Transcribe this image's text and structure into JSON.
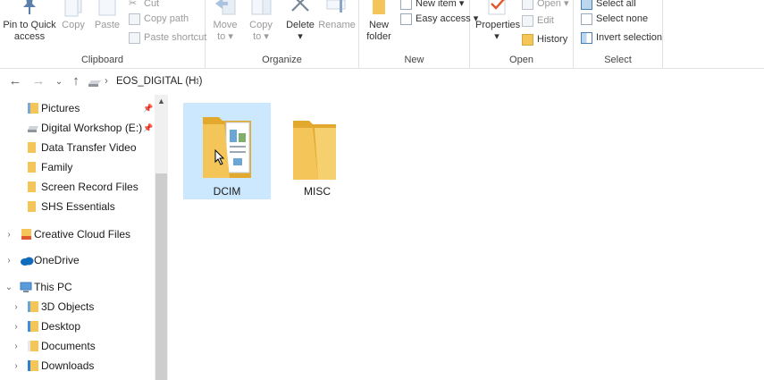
{
  "ribbon": {
    "clipboard": {
      "label": "Clipboard",
      "pin_label_line1": "Pin to Quick",
      "pin_label_line2": "access",
      "copy_label": "Copy",
      "paste_label": "Paste",
      "cut_label": "Cut",
      "copy_path_label": "Copy path",
      "paste_shortcut_label": "Paste shortcut"
    },
    "organize": {
      "label": "Organize",
      "move_to_line1": "Move",
      "move_to_line2": "to",
      "copy_to_line1": "Copy",
      "copy_to_line2": "to",
      "delete_label": "Delete",
      "rename_label": "Rename"
    },
    "new": {
      "label": "New",
      "new_folder_line1": "New",
      "new_folder_line2": "folder",
      "new_item_label": "New item",
      "easy_access_label": "Easy access"
    },
    "open": {
      "label": "Open",
      "properties_label": "Properties",
      "open_label": "Open",
      "edit_label": "Edit",
      "history_label": "History"
    },
    "select": {
      "label": "Select",
      "select_all_label": "Select all",
      "select_none_label": "Select none",
      "invert_selection_label": "Invert selection"
    }
  },
  "address": {
    "path_segment": "EOS_DIGITAL (H:)"
  },
  "nav": {
    "quick_access": [
      {
        "label": "Pictures",
        "pinned": true
      },
      {
        "label": "Digital Workshop (E:)",
        "pinned": true
      },
      {
        "label": "Data Transfer Video",
        "pinned": false
      },
      {
        "label": "Family",
        "pinned": false
      },
      {
        "label": "Screen Record Files",
        "pinned": false
      },
      {
        "label": "SHS Essentials",
        "pinned": false
      }
    ],
    "creative_cloud": "Creative Cloud Files",
    "onedrive": "OneDrive",
    "this_pc": "This PC",
    "this_pc_children": [
      "3D Objects",
      "Desktop",
      "Documents",
      "Downloads"
    ]
  },
  "content": {
    "folders": [
      {
        "label": "DCIM",
        "selected": true
      },
      {
        "label": "MISC",
        "selected": false
      }
    ]
  },
  "colors": {
    "selection": "#cce8ff",
    "folder": "#f4c65a",
    "folder_dark": "#e3a92e",
    "onedrive": "#0f6cbd",
    "accent": "#1a73c8"
  }
}
